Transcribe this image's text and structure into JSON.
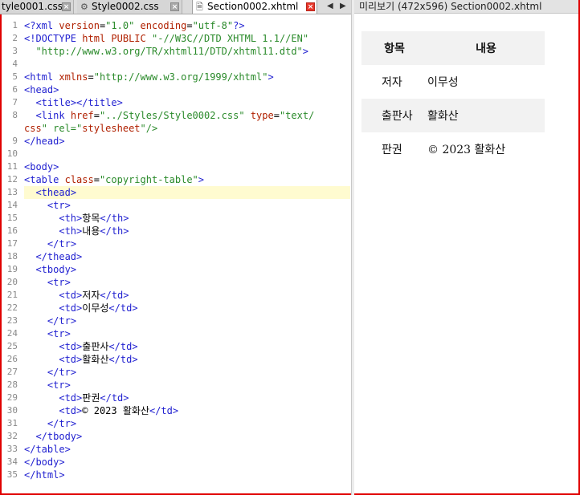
{
  "tabs": [
    {
      "label": "tyle0001.css",
      "state": "inactive"
    },
    {
      "label": "Style0002.css",
      "state": "inactive",
      "icon": "gear-icon"
    },
    {
      "label": "Section0002.xhtml",
      "state": "active",
      "icon": "document-icon"
    }
  ],
  "preview_title": "미리보기 (472x596) Section0002.xhtml",
  "line_numbers": [
    "1",
    "2",
    "3",
    "4",
    "5",
    "6",
    "7",
    "8",
    "",
    "9",
    "10",
    "11",
    "12",
    "13",
    "14",
    "15",
    "16",
    "17",
    "18",
    "19",
    "20",
    "21",
    "22",
    "23",
    "24",
    "25",
    "26",
    "27",
    "28",
    "29",
    "30",
    "31",
    "32",
    "33",
    "34",
    "35"
  ],
  "code_lines": [
    "<?xml version=\"1.0\" encoding=\"utf-8\"?>",
    "<!DOCTYPE html PUBLIC \"-//W3C//DTD XHTML 1.1//EN\"",
    "  \"http://www.w3.org/TR/xhtml11/DTD/xhtml11.dtd\">",
    "",
    "<html xmlns=\"http://www.w3.org/1999/xhtml\">",
    "<head>",
    "  <title></title>",
    "  <link href=\"../Styles/Style0002.css\" type=\"text/",
    "css\" rel=\"stylesheet\"/>",
    "</head>",
    "",
    "<body>",
    "<table class=\"copyright-table\">",
    "  <thead>",
    "    <tr>",
    "      <th>항목</th>",
    "      <th>내용</th>",
    "    </tr>",
    "  </thead>",
    "  <tbody>",
    "    <tr>",
    "      <td>저자</td>",
    "      <td>이무성</td>",
    "    </tr>",
    "    <tr>",
    "      <td>출판사</td>",
    "      <td>활화산</td>",
    "    </tr>",
    "    <tr>",
    "      <td>판권</td>",
    "      <td>© 2023 활화산</td>",
    "    </tr>",
    "  </tbody>",
    "</table>",
    "</body>",
    "</html>"
  ],
  "highlighted_line_index": 13,
  "preview_table": {
    "headers": [
      "항목",
      "내용"
    ],
    "rows": [
      [
        "저자",
        "이무성"
      ],
      [
        "출판사",
        "활화산"
      ],
      [
        "판권",
        "© 2023 활화산"
      ]
    ]
  },
  "colors": {
    "frame": "#e00000",
    "tag": "#1f1fd0",
    "attr": "#b02000",
    "value": "#2a8a2a",
    "highlight": "#fffbd0"
  }
}
